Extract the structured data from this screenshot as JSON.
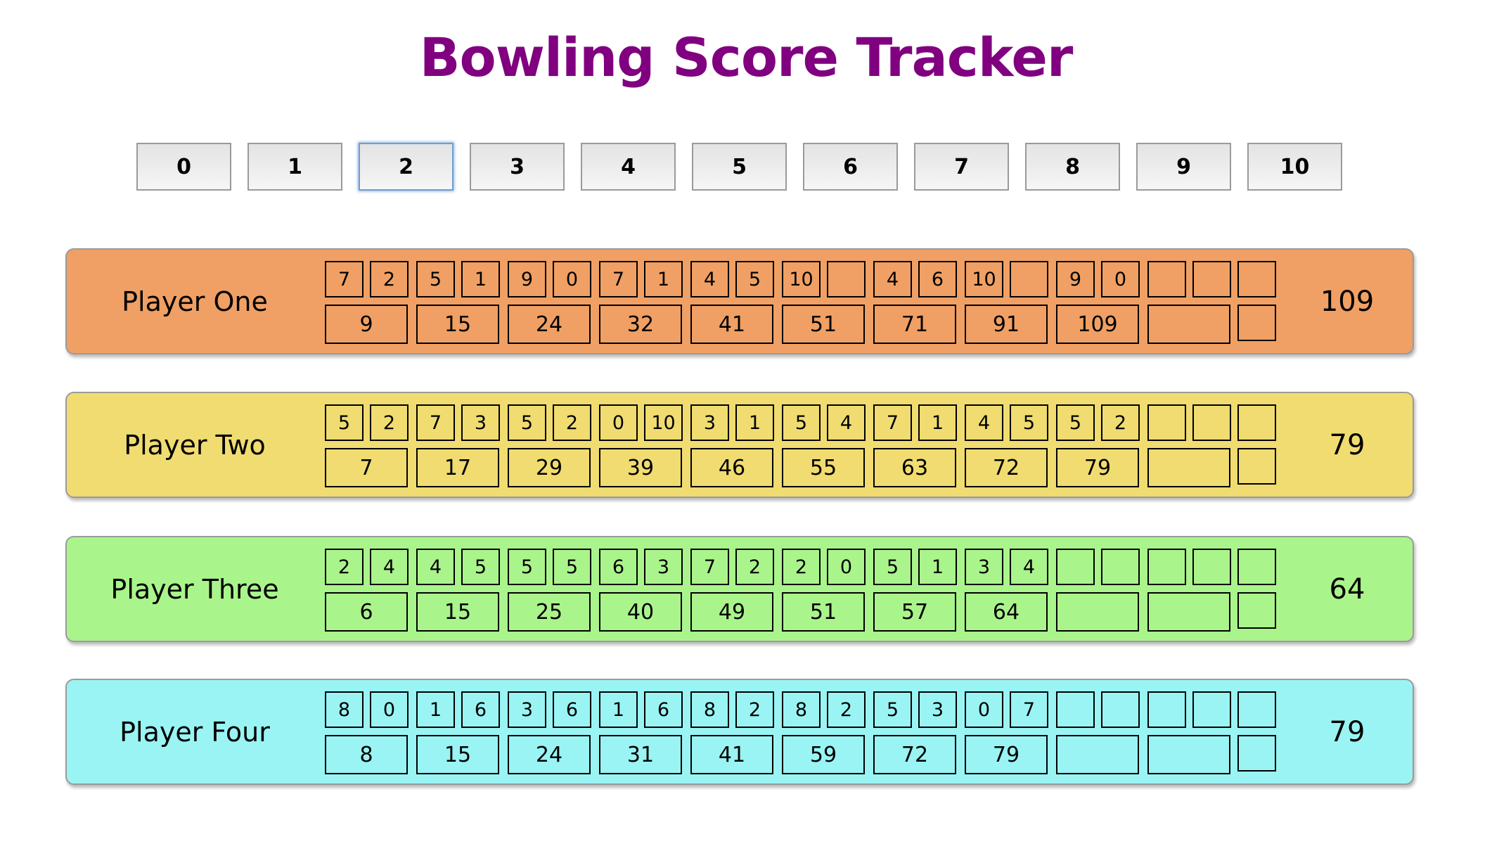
{
  "title": "Bowling Score Tracker",
  "pin_buttons": {
    "labels": [
      "0",
      "1",
      "2",
      "3",
      "4",
      "5",
      "6",
      "7",
      "8",
      "9",
      "10"
    ],
    "focused_index": 2
  },
  "players": [
    {
      "name": "Player One",
      "color": "#F0A064",
      "frames": [
        {
          "rolls": [
            "7",
            "2"
          ],
          "total": "9"
        },
        {
          "rolls": [
            "5",
            "1"
          ],
          "total": "15"
        },
        {
          "rolls": [
            "9",
            "0"
          ],
          "total": "24"
        },
        {
          "rolls": [
            "7",
            "1"
          ],
          "total": "32"
        },
        {
          "rolls": [
            "4",
            "5"
          ],
          "total": "41"
        },
        {
          "rolls": [
            "10",
            ""
          ],
          "total": "51"
        },
        {
          "rolls": [
            "4",
            "6"
          ],
          "total": "71"
        },
        {
          "rolls": [
            "10",
            ""
          ],
          "total": "91"
        },
        {
          "rolls": [
            "9",
            "0"
          ],
          "total": "109"
        },
        {
          "rolls": [
            "",
            "",
            ""
          ],
          "total": "",
          "bonus": ""
        }
      ],
      "score": "109"
    },
    {
      "name": "Player Two",
      "color": "#F0DC70",
      "frames": [
        {
          "rolls": [
            "5",
            "2"
          ],
          "total": "7"
        },
        {
          "rolls": [
            "7",
            "3"
          ],
          "total": "17"
        },
        {
          "rolls": [
            "5",
            "2"
          ],
          "total": "29"
        },
        {
          "rolls": [
            "0",
            "10"
          ],
          "total": "39"
        },
        {
          "rolls": [
            "3",
            "1"
          ],
          "total": "46"
        },
        {
          "rolls": [
            "5",
            "4"
          ],
          "total": "55"
        },
        {
          "rolls": [
            "7",
            "1"
          ],
          "total": "63"
        },
        {
          "rolls": [
            "4",
            "5"
          ],
          "total": "72"
        },
        {
          "rolls": [
            "5",
            "2"
          ],
          "total": "79"
        },
        {
          "rolls": [
            "",
            "",
            ""
          ],
          "total": "",
          "bonus": ""
        }
      ],
      "score": "79"
    },
    {
      "name": "Player Three",
      "color": "#AAF48C",
      "frames": [
        {
          "rolls": [
            "2",
            "4"
          ],
          "total": "6"
        },
        {
          "rolls": [
            "4",
            "5"
          ],
          "total": "15"
        },
        {
          "rolls": [
            "5",
            "5"
          ],
          "total": "25"
        },
        {
          "rolls": [
            "6",
            "3"
          ],
          "total": "40"
        },
        {
          "rolls": [
            "7",
            "2"
          ],
          "total": "49"
        },
        {
          "rolls": [
            "2",
            "0"
          ],
          "total": "51"
        },
        {
          "rolls": [
            "5",
            "1"
          ],
          "total": "57"
        },
        {
          "rolls": [
            "3",
            "4"
          ],
          "total": "64"
        },
        {
          "rolls": [
            "",
            ""
          ],
          "total": ""
        },
        {
          "rolls": [
            "",
            "",
            ""
          ],
          "total": "",
          "bonus": ""
        }
      ],
      "score": "64"
    },
    {
      "name": "Player Four",
      "color": "#9AF4F4",
      "frames": [
        {
          "rolls": [
            "8",
            "0"
          ],
          "total": "8"
        },
        {
          "rolls": [
            "1",
            "6"
          ],
          "total": "15"
        },
        {
          "rolls": [
            "3",
            "6"
          ],
          "total": "24"
        },
        {
          "rolls": [
            "1",
            "6"
          ],
          "total": "31"
        },
        {
          "rolls": [
            "8",
            "2"
          ],
          "total": "41"
        },
        {
          "rolls": [
            "8",
            "2"
          ],
          "total": "59"
        },
        {
          "rolls": [
            "5",
            "3"
          ],
          "total": "72"
        },
        {
          "rolls": [
            "0",
            "7"
          ],
          "total": "79"
        },
        {
          "rolls": [
            "",
            ""
          ],
          "total": ""
        },
        {
          "rolls": [
            "",
            "",
            ""
          ],
          "total": "",
          "bonus": ""
        }
      ],
      "score": "79"
    }
  ]
}
